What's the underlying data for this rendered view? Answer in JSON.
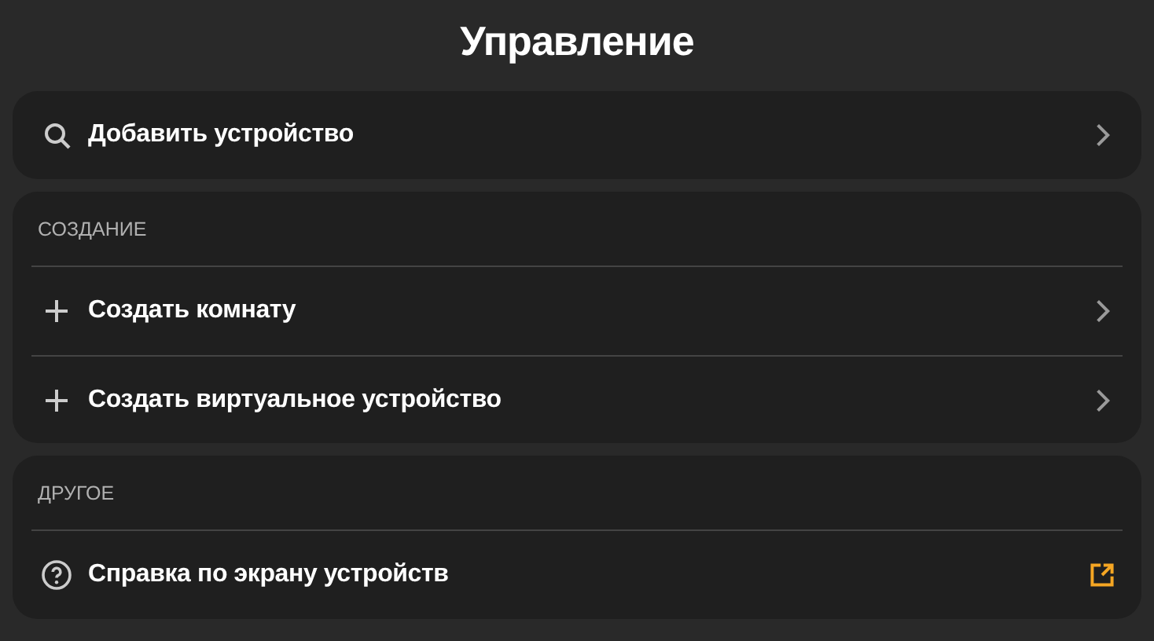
{
  "title": "Управление",
  "sections": [
    {
      "items": [
        {
          "kind": "search",
          "label": "Добавить устройство"
        }
      ]
    },
    {
      "header": "СОЗДАНИЕ",
      "items": [
        {
          "kind": "create",
          "label": "Создать комнату"
        },
        {
          "kind": "create",
          "label": "Создать виртуальное устройство"
        }
      ]
    },
    {
      "header": "ДРУГОЕ",
      "items": [
        {
          "kind": "help",
          "label": "Справка по экрану устройств"
        }
      ]
    }
  ]
}
